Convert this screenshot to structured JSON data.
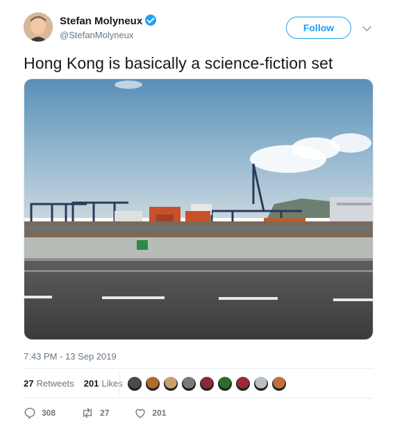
{
  "author": {
    "display_name": "Stefan Molyneux",
    "handle": "@StefanMolyneux",
    "verified": true
  },
  "follow_label": "Follow",
  "tweet": {
    "text": "Hong Kong is basically a science-fiction set",
    "timestamp": "7:43 PM - 13 Sep 2019"
  },
  "stats": {
    "retweets": "27",
    "retweets_label": "Retweets",
    "likes": "201",
    "likes_label": "Likes"
  },
  "liker_colors": [
    "#4a4a4a",
    "#b06a2a",
    "#c9a06a",
    "#7a7a7a",
    "#8a2a3a",
    "#2f6a2a",
    "#9a2a3a",
    "#b7bfc7",
    "#c0703a"
  ],
  "actions": {
    "replies": "308",
    "retweets": "27",
    "likes": "201"
  },
  "colors": {
    "accent": "#1da1f2",
    "secondary_text": "#657786"
  },
  "icons": [
    "verified-badge-icon",
    "chevron-down-icon",
    "reply-icon",
    "retweet-icon",
    "like-icon"
  ]
}
